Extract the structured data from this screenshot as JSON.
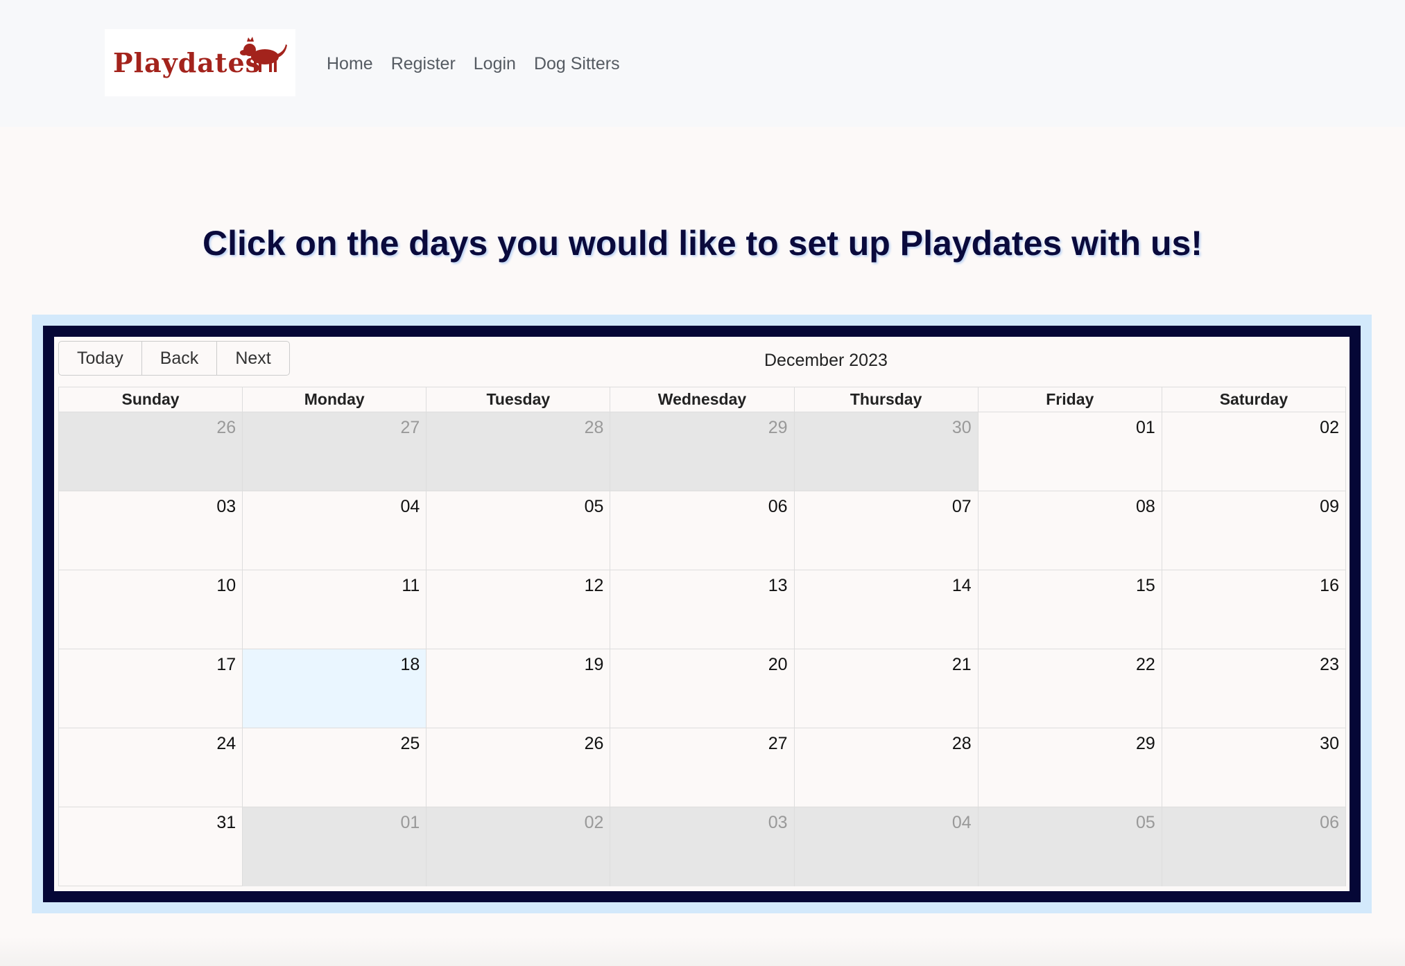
{
  "nav": {
    "logo_text": "Playdates",
    "links": [
      "Home",
      "Register",
      "Login",
      "Dog Sitters"
    ]
  },
  "headline": "Click on the days you would like to set up Playdates with us!",
  "calendar": {
    "buttons": {
      "today": "Today",
      "back": "Back",
      "next": "Next"
    },
    "month_label": "December 2023",
    "weekdays": [
      "Sunday",
      "Monday",
      "Tuesday",
      "Wednesday",
      "Thursday",
      "Friday",
      "Saturday"
    ],
    "today_date": "18",
    "weeks": [
      [
        {
          "d": "26",
          "off": true
        },
        {
          "d": "27",
          "off": true
        },
        {
          "d": "28",
          "off": true
        },
        {
          "d": "29",
          "off": true
        },
        {
          "d": "30",
          "off": true
        },
        {
          "d": "01"
        },
        {
          "d": "02"
        }
      ],
      [
        {
          "d": "03"
        },
        {
          "d": "04"
        },
        {
          "d": "05"
        },
        {
          "d": "06"
        },
        {
          "d": "07"
        },
        {
          "d": "08"
        },
        {
          "d": "09"
        }
      ],
      [
        {
          "d": "10"
        },
        {
          "d": "11"
        },
        {
          "d": "12"
        },
        {
          "d": "13"
        },
        {
          "d": "14"
        },
        {
          "d": "15"
        },
        {
          "d": "16"
        }
      ],
      [
        {
          "d": "17"
        },
        {
          "d": "18",
          "today": true
        },
        {
          "d": "19"
        },
        {
          "d": "20"
        },
        {
          "d": "21"
        },
        {
          "d": "22"
        },
        {
          "d": "23"
        }
      ],
      [
        {
          "d": "24"
        },
        {
          "d": "25"
        },
        {
          "d": "26"
        },
        {
          "d": "27"
        },
        {
          "d": "28"
        },
        {
          "d": "29"
        },
        {
          "d": "30"
        }
      ],
      [
        {
          "d": "31"
        },
        {
          "d": "01",
          "off": true
        },
        {
          "d": "02",
          "off": true
        },
        {
          "d": "03",
          "off": true
        },
        {
          "d": "04",
          "off": true
        },
        {
          "d": "05",
          "off": true
        },
        {
          "d": "06",
          "off": true
        }
      ]
    ]
  },
  "colors": {
    "brand_red": "#a3231c",
    "headline": "#0a0a3c",
    "frame_dark": "#050736",
    "frame_light": "#d3e9fb",
    "off_day": "#e6e6e6",
    "today_day": "#eaf6ff"
  }
}
